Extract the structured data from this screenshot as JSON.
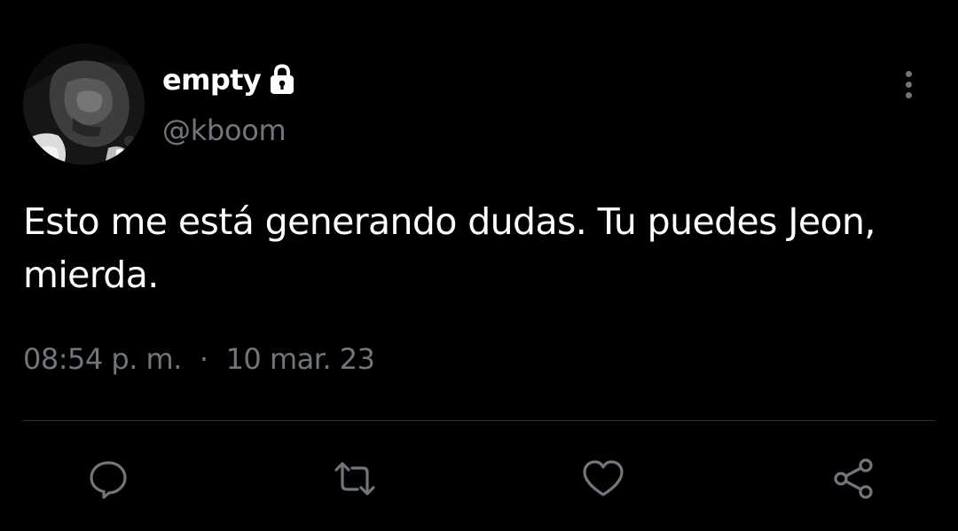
{
  "tweet": {
    "display_name": "empty",
    "handle": "@kboom",
    "text": "Esto me está generando dudas. Tu puedes Jeon, mierda.",
    "time": "08:54 p. m.",
    "separator": "·",
    "date": "10 mar. 23",
    "verified_icon": "lock-icon"
  },
  "header": {
    "more_icon": "more-vertical-icon"
  },
  "actions": [
    {
      "name": "reply",
      "icon": "reply-icon"
    },
    {
      "name": "retweet",
      "icon": "retweet-icon"
    },
    {
      "name": "like",
      "icon": "heart-icon"
    },
    {
      "name": "share",
      "icon": "share-icon"
    }
  ],
  "colors": {
    "background": "#000000",
    "primary_text": "#ffffff",
    "secondary_text": "#71767b",
    "divider": "#2f3336"
  }
}
